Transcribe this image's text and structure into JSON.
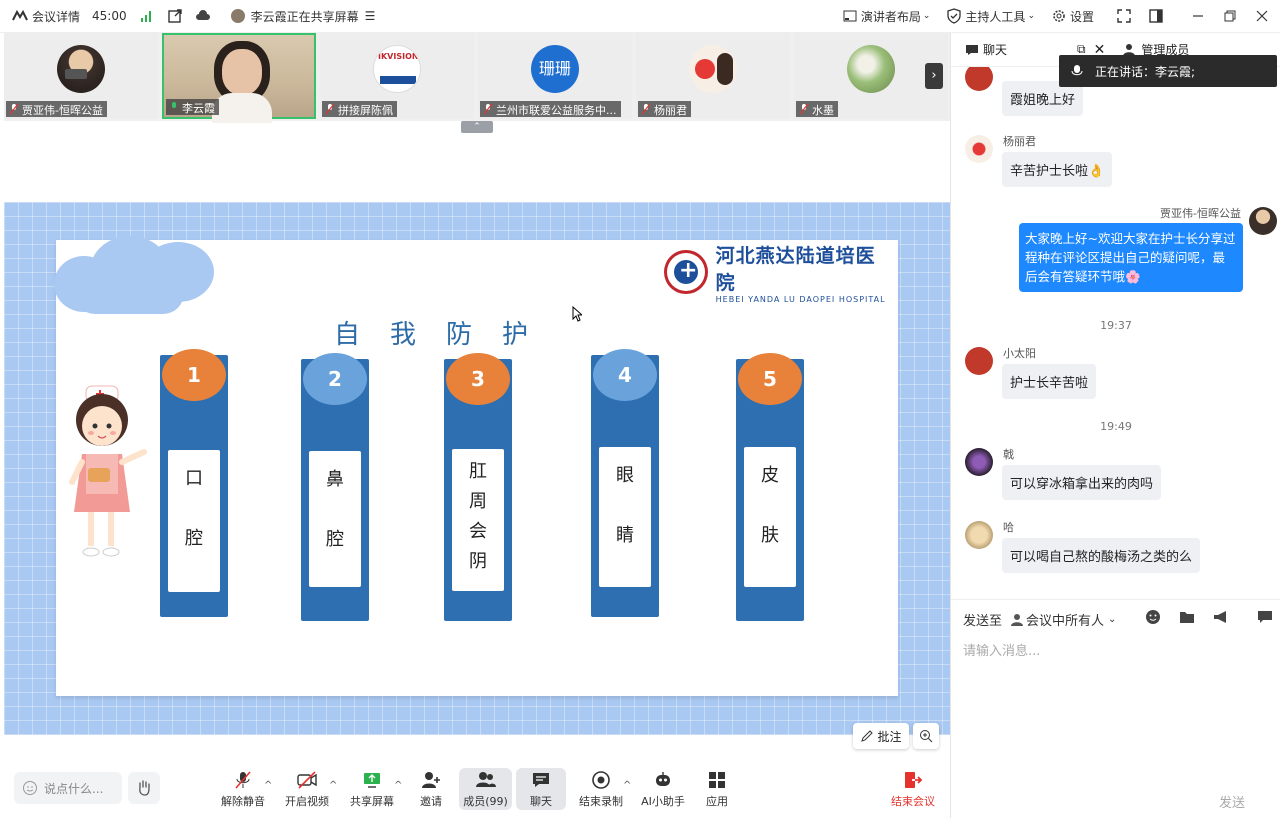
{
  "topbar": {
    "meeting_details": "会议详情",
    "timer": "45:00",
    "sharing_status": "李云霞正在共享屏幕",
    "speaker_layout": "演讲者布局",
    "host_tools": "主持人工具",
    "settings": "设置"
  },
  "participants": [
    {
      "name": "贾亚伟-恒晖公益"
    },
    {
      "name": "李云霞"
    },
    {
      "name": "拼接屏陈佩"
    },
    {
      "name": "兰州市联爱公益服务中...",
      "avatar_text": "珊珊"
    },
    {
      "name": "杨丽君"
    },
    {
      "name": "水墨"
    }
  ],
  "slide": {
    "hospital_cn": "河北燕达陆道培医院",
    "hospital_en": "HEBEI YANDA LU DAOPEI HOSPITAL",
    "title": "自我防护",
    "pillars": [
      {
        "num": "1",
        "text": [
          "口",
          "腔"
        ],
        "color": "#e8823a"
      },
      {
        "num": "2",
        "text": [
          "鼻",
          "腔"
        ],
        "color": "#6aa3dc"
      },
      {
        "num": "3",
        "text": [
          "肛",
          "周",
          "会",
          "阴"
        ],
        "color": "#e8823a"
      },
      {
        "num": "4",
        "text": [
          "眼",
          "睛"
        ],
        "color": "#6aa3dc"
      },
      {
        "num": "5",
        "text": [
          "皮",
          "肤"
        ],
        "color": "#e8823a"
      }
    ]
  },
  "annotate": {
    "label": "批注"
  },
  "toolbar": {
    "say_placeholder": "说点什么...",
    "unmute": "解除静音",
    "start_video": "开启视频",
    "share_screen": "共享屏幕",
    "invite": "邀请",
    "members": "成员(99)",
    "chat": "聊天",
    "end_recording": "结束录制",
    "ai_assistant": "AI小助手",
    "apps": "应用",
    "end_meeting": "结束会议"
  },
  "chat": {
    "tab_chat": "聊天",
    "tab_members": "管理成员",
    "now_speaking": "正在讲话：李云霞;",
    "messages": [
      {
        "sender": "小太阳",
        "text": "霞姐晚上好"
      },
      {
        "sender": "杨丽君",
        "text": "辛苦护士长啦👌"
      },
      {
        "sender": "贾亚伟-恒晖公益",
        "text_lines": [
          "大家晚上好~欢迎大家在护士长分享过",
          "程种在评论区提出自己的疑问呢，最",
          "后会有答疑环节哦🌸"
        ]
      },
      {
        "sender": "小太阳",
        "text": "护士长辛苦啦"
      },
      {
        "sender": "戟",
        "text": "可以穿冰箱拿出来的肉吗"
      },
      {
        "sender": "哈",
        "text": "可以喝自己熬的酸梅汤之类的么"
      }
    ],
    "time1": "19:37",
    "time2": "19:49",
    "send_to_label": "发送至",
    "send_to_target": "会议中所有人",
    "input_placeholder": "请输入消息...",
    "send": "发送"
  },
  "colors": {
    "accent": "#1e88ff",
    "end_red": "#e5322d",
    "slide_blue": "#2d6fb0"
  }
}
